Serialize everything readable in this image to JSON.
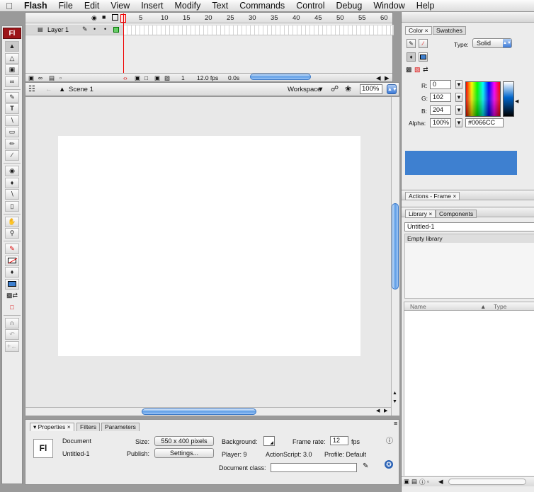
{
  "menubar": {
    "app": "Flash",
    "items": [
      "File",
      "Edit",
      "View",
      "Insert",
      "Modify",
      "Text",
      "Commands",
      "Control",
      "Debug",
      "Window",
      "Help"
    ]
  },
  "tools": {
    "logo": "Fl"
  },
  "timeline": {
    "frame_numbers": [
      "1",
      "5",
      "10",
      "15",
      "20",
      "25",
      "30",
      "35",
      "40",
      "45",
      "50",
      "55",
      "60"
    ],
    "layer_name": "Layer 1",
    "current_frame": "1",
    "fps": "12.0 fps",
    "time": "0.0s"
  },
  "editbar": {
    "scene": "Scene 1",
    "workspace": "Workspace",
    "zoom": "100%"
  },
  "properties": {
    "tabs": [
      "Properties",
      "Filters",
      "Parameters"
    ],
    "logo": "Fl",
    "doc_type": "Document",
    "doc_name": "Untitled-1",
    "size_label": "Size:",
    "size_value": "550 x 400 pixels",
    "background_label": "Background:",
    "frame_rate_label": "Frame rate:",
    "frame_rate": "12",
    "fps_unit": "fps",
    "publish_label": "Publish:",
    "settings_button": "Settings...",
    "player": "Player: 9",
    "actionscript": "ActionScript: 3.0",
    "profile": "Profile: Default",
    "doc_class_label": "Document class:"
  },
  "color_panel": {
    "tabs": [
      "Color",
      "Swatches"
    ],
    "type_label": "Type:",
    "type_value": "Solid",
    "r_label": "R:",
    "r": "0",
    "g_label": "G:",
    "g": "102",
    "b_label": "B:",
    "b": "204",
    "alpha_label": "Alpha:",
    "alpha": "100%",
    "hex": "#0066CC",
    "swatch_color": "#3e80d0"
  },
  "actions_panel": {
    "title": "Actions - Frame"
  },
  "library": {
    "tabs": [
      "Library",
      "Components"
    ],
    "doc": "Untitled-1",
    "status": "Empty library",
    "col_name": "Name",
    "col_type": "Type"
  }
}
